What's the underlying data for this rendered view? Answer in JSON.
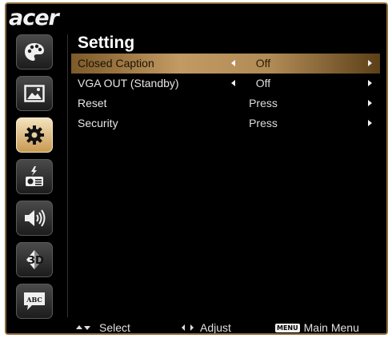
{
  "brand": {
    "logo_text": "acer"
  },
  "sidebar": {
    "items": [
      {
        "name": "color",
        "icon": "palette-icon",
        "active": false
      },
      {
        "name": "image",
        "icon": "picture-icon",
        "active": false
      },
      {
        "name": "setting",
        "icon": "gear-icon",
        "active": true
      },
      {
        "name": "management",
        "icon": "projector-icon",
        "active": false
      },
      {
        "name": "audio",
        "icon": "speaker-icon",
        "active": false
      },
      {
        "name": "3d",
        "icon": "3d-icon",
        "badge": "3D",
        "active": false
      },
      {
        "name": "language",
        "icon": "speech-bubble-icon",
        "badge": "ABC",
        "active": false
      }
    ]
  },
  "main": {
    "title": "Setting",
    "rows": [
      {
        "label": "Closed Caption",
        "value": "Off",
        "has_left_arrow": true,
        "selected": true
      },
      {
        "label": "VGA OUT (Standby)",
        "value": "Off",
        "has_left_arrow": true,
        "selected": false
      },
      {
        "label": "Reset",
        "value": "Press",
        "has_left_arrow": false,
        "selected": false
      },
      {
        "label": "Security",
        "value": "Press",
        "has_left_arrow": false,
        "selected": false
      }
    ]
  },
  "footer": {
    "select_label": "Select",
    "adjust_label": "Adjust",
    "menu_key": "MENU",
    "main_menu_label": "Main Menu"
  },
  "colors": {
    "accent": "#c29a63",
    "frame": "#8a6a3a",
    "background": "#000000"
  }
}
